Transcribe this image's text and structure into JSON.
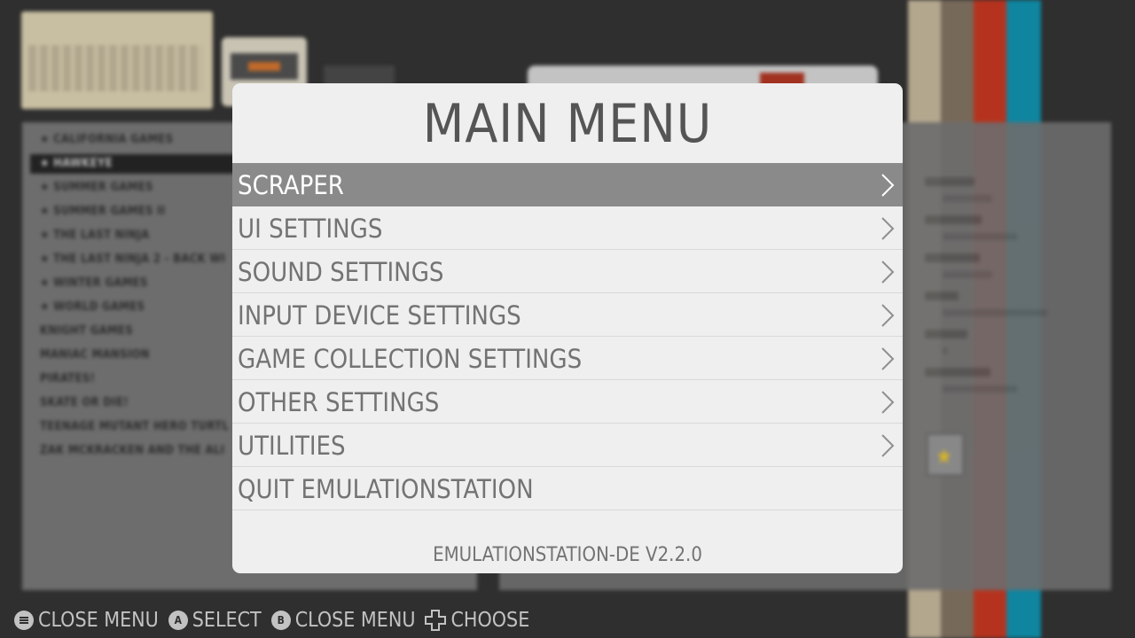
{
  "background": {
    "stripes": [
      "#b3a78e",
      "#77695a",
      "#b5331e",
      "#0f85a0"
    ],
    "games": [
      "★ CALIFORNIA GAMES",
      "★ HAWKEYE",
      "★ SUMMER GAMES",
      "★ SUMMER GAMES II",
      "★ THE LAST NINJA",
      "★ THE LAST NINJA 2 - BACK WI",
      "★ WINTER GAMES",
      "★ WORLD GAMES",
      "KNIGHT GAMES",
      "MANIAC MANSION",
      "PIRATES!",
      "SKATE OR DIE!",
      "TEENAGE MUTANT HERO TURTL",
      "ZAK MCKRACKEN AND THE ALI"
    ],
    "selected_game_index": 1
  },
  "menu": {
    "title": "MAIN MENU",
    "items": [
      {
        "label": "SCRAPER",
        "has_submenu": true,
        "selected": true
      },
      {
        "label": "UI SETTINGS",
        "has_submenu": true
      },
      {
        "label": "SOUND SETTINGS",
        "has_submenu": true
      },
      {
        "label": "INPUT DEVICE SETTINGS",
        "has_submenu": true
      },
      {
        "label": "GAME COLLECTION SETTINGS",
        "has_submenu": true
      },
      {
        "label": "OTHER SETTINGS",
        "has_submenu": true
      },
      {
        "label": "UTILITIES",
        "has_submenu": true
      },
      {
        "label": "QUIT EMULATIONSTATION",
        "has_submenu": false
      }
    ],
    "version": "EMULATIONSTATION-DE  V2.2.0"
  },
  "help": [
    {
      "icon": "menu-button-icon",
      "label": "CLOSE MENU"
    },
    {
      "icon": "a-button-icon",
      "glyph": "A",
      "label": "SELECT"
    },
    {
      "icon": "b-button-icon",
      "glyph": "B",
      "label": "CLOSE MENU"
    },
    {
      "icon": "dpad-icon",
      "label": "CHOOSE"
    }
  ],
  "colors": {
    "menu_bg": "#efefef",
    "menu_text": "#737373",
    "selected_row": "#8a8a8a",
    "selected_text": "#ffffff",
    "help_text": "#c2c2c2"
  }
}
